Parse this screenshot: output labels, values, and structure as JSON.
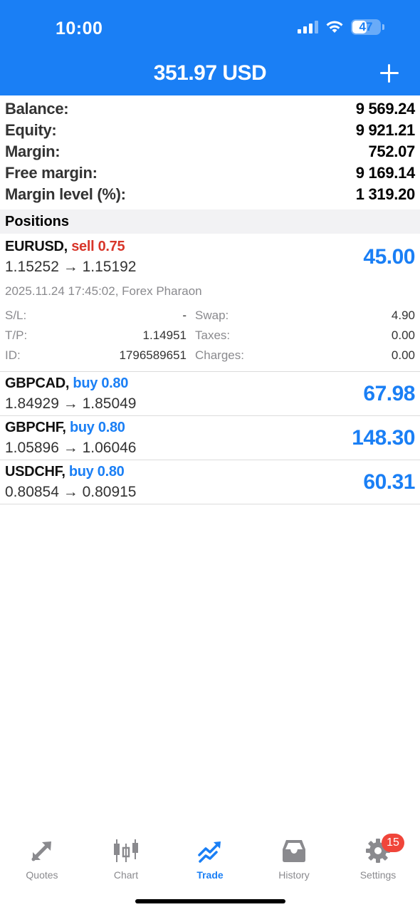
{
  "status_bar": {
    "time": "10:00",
    "battery": "47"
  },
  "header": {
    "title": "351.97 USD"
  },
  "summary": [
    {
      "label": "Balance:",
      "value": "9 569.24"
    },
    {
      "label": "Equity:",
      "value": "9 921.21"
    },
    {
      "label": "Margin:",
      "value": "752.07"
    },
    {
      "label": "Free margin:",
      "value": "9 169.14"
    },
    {
      "label": "Margin level (%):",
      "value": "1 319.20"
    }
  ],
  "positions_title": "Positions",
  "positions": [
    {
      "symbol": "EURUSD,",
      "side": "sell 0.75",
      "prices": "1.15252 → 1.15192",
      "profit": "45.00",
      "meta": "2025.11.24 17:45:02, Forex Pharaon",
      "details": [
        {
          "k1": "S/L:",
          "v1": "-",
          "k2": "Swap:",
          "v2": "4.90"
        },
        {
          "k1": "T/P:",
          "v1": "1.14951",
          "k2": "Taxes:",
          "v2": "0.00"
        },
        {
          "k1": "ID:",
          "v1": "1796589651",
          "k2": "Charges:",
          "v2": "0.00"
        }
      ]
    },
    {
      "symbol": "GBPCAD,",
      "side": "buy 0.80",
      "prices": "1.84929 → 1.85049",
      "profit": "67.98"
    },
    {
      "symbol": "GBPCHF,",
      "side": "buy 0.80",
      "prices": "1.05896 → 1.06046",
      "profit": "148.30"
    },
    {
      "symbol": "USDCHF,",
      "side": "buy 0.80",
      "prices": "0.80854 → 0.80915",
      "profit": "60.31"
    }
  ],
  "tabs": [
    {
      "label": "Quotes",
      "icon": "quotes-icon"
    },
    {
      "label": "Chart",
      "icon": "chart-icon"
    },
    {
      "label": "Trade",
      "icon": "trade-icon",
      "active": true
    },
    {
      "label": "History",
      "icon": "history-icon"
    },
    {
      "label": "Settings",
      "icon": "gear-icon",
      "badge": "15"
    }
  ],
  "colors": {
    "accent": "#1a7ff5",
    "sell": "#d8362a",
    "badge": "#f0453a"
  }
}
